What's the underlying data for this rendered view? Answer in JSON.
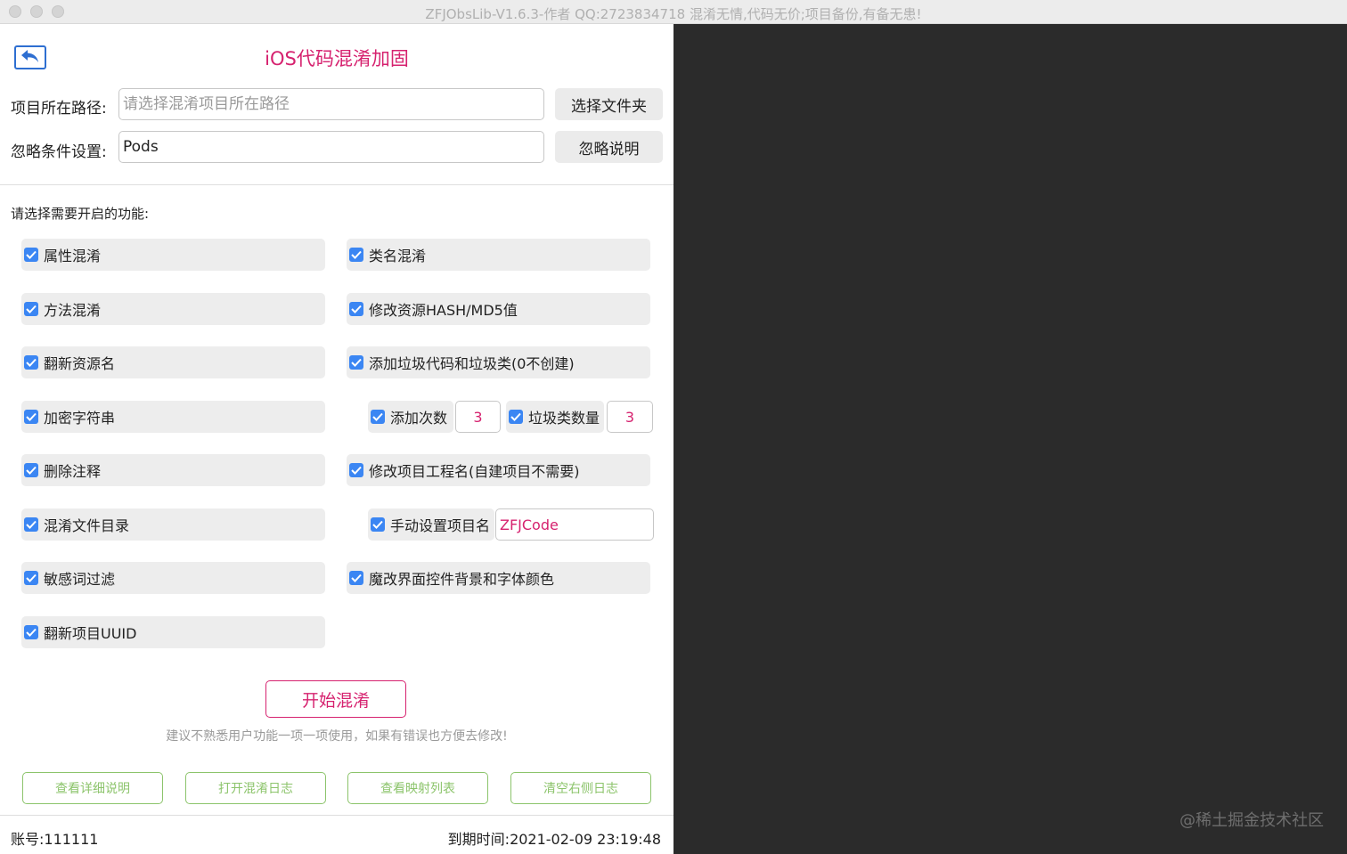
{
  "window": {
    "title": "ZFJObsLib-V1.6.3-作者 QQ:2723834718  混淆无情,代码无价;项目备份,有备无患!"
  },
  "header": {
    "title": "iOS代码混淆加固",
    "back_icon": "back-arrow-icon"
  },
  "form": {
    "path_label": "项目所在路径:",
    "path_value": "",
    "path_placeholder": "请选择混淆项目所在路径",
    "select_folder_label": "选择文件夹",
    "ignore_label": "忽略条件设置:",
    "ignore_value": "Pods",
    "ignore_help_label": "忽略说明"
  },
  "features": {
    "section_label": "请选择需要开启的功能:",
    "left": [
      {
        "label": "属性混淆",
        "checked": true
      },
      {
        "label": "方法混淆",
        "checked": true
      },
      {
        "label": "翻新资源名",
        "checked": true
      },
      {
        "label": "加密字符串",
        "checked": true
      },
      {
        "label": "删除注释",
        "checked": true
      },
      {
        "label": "混淆文件目录",
        "checked": true
      },
      {
        "label": "敏感词过滤",
        "checked": true
      },
      {
        "label": "翻新项目UUID",
        "checked": true
      }
    ],
    "right": [
      {
        "label": "类名混淆",
        "checked": true
      },
      {
        "label": "修改资源HASH/MD5值",
        "checked": true
      },
      {
        "label": "添加垃圾代码和垃圾类(0不创建)",
        "checked": true
      },
      {
        "label": "修改项目工程名(自建项目不需要)",
        "checked": true
      },
      {
        "label": "魔改界面控件背景和字体颜色",
        "checked": true
      }
    ],
    "add_count_label": "添加次数",
    "add_count_value": "3",
    "junk_count_label": "垃圾类数量",
    "junk_count_value": "3",
    "manual_name_label": "手动设置项目名",
    "manual_name_value": "ZFJCode"
  },
  "actions": {
    "start_label": "开始混淆",
    "hint": "建议不熟悉用户功能一项一项使用，如果有错误也方便去修改!",
    "buttons": [
      "查看详细说明",
      "打开混淆日志",
      "查看映射列表",
      "清空右侧日志"
    ]
  },
  "footer": {
    "account": "账号:111111",
    "expiry": "到期时间:2021-02-09 23:19:48"
  },
  "log_panel": {
    "watermark": "@稀土掘金技术社区"
  },
  "colors": {
    "accent": "#d6226f",
    "checkbox": "#3b86f3",
    "secondary_button": "#8cc46b",
    "log_background": "#2b2b2b"
  }
}
